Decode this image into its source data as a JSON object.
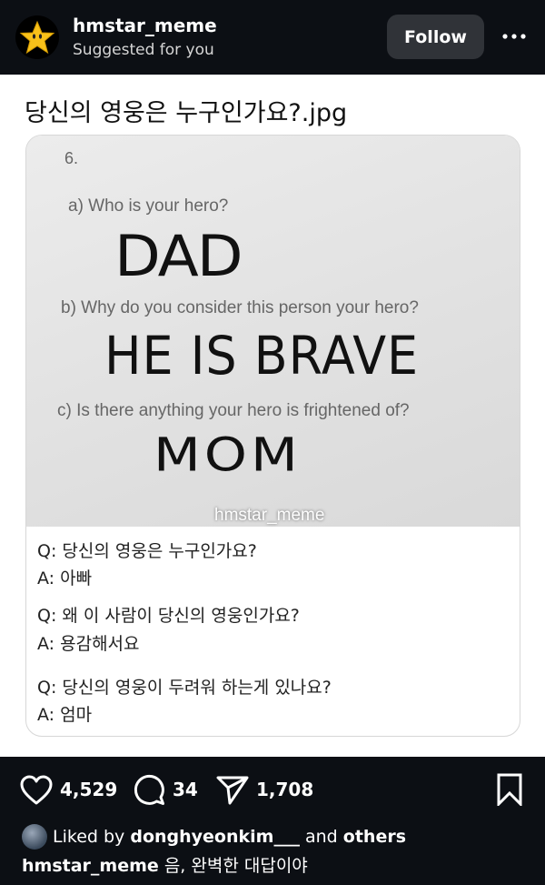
{
  "header": {
    "author": "hmstar_meme",
    "subtitle": "Suggested for you",
    "follow_label": "Follow",
    "more_icon": "ellipsis-icon",
    "avatar_icon": "star-icon"
  },
  "post": {
    "title": "당신의 영웅은 누구인가요?.jpg",
    "image": {
      "question_number": "6.",
      "q_a": "a) Who is your hero?",
      "answer_a": "DAD",
      "q_b": "b) Why do you consider this person your hero?",
      "answer_b": "HE IS BRAVE",
      "q_c": "c) Is there anything your hero is frightened of?",
      "answer_c": "MOM",
      "watermark": "hmstar_meme"
    },
    "translation": [
      {
        "q": "Q: 당신의 영웅은 누구인가요?",
        "a": "A: 아빠"
      },
      {
        "q": "Q: 왜 이 사람이 당신의 영웅인가요?",
        "a": "A: 용감해서요"
      },
      {
        "q": "Q: 당신의 영웅이 두려워 하는게 있나요?",
        "a": "A: 엄마"
      }
    ]
  },
  "actions": {
    "likes": "4,529",
    "comments": "34",
    "shares": "1,708"
  },
  "liked_by": {
    "prefix": "Liked by",
    "user": "donghyeonkim___",
    "and": "and",
    "others": "others"
  },
  "caption": {
    "author": "hmstar_meme",
    "text": "음, 완벽한 대답이야"
  },
  "colors": {
    "bar_bg": "#0c0f14",
    "follow_bg": "#303338",
    "content_bg": "#ffffff"
  }
}
